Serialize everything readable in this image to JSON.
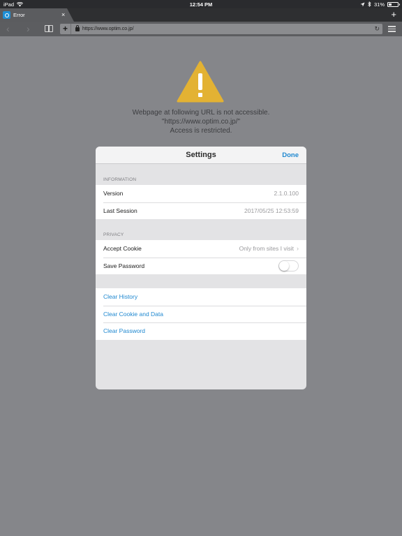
{
  "status_bar": {
    "device": "iPad",
    "time": "12:54 PM",
    "battery": "31%"
  },
  "tab": {
    "title": "Error",
    "close": "×",
    "new_tab": "+"
  },
  "toolbar": {
    "back": "‹",
    "forward": "›",
    "add": "+",
    "url": "https://www.optim.co.jp/",
    "reload": "↻"
  },
  "error": {
    "line1": "Webpage at following URL is not accessible.",
    "line2": "\"https://www.optim.co.jp/\"",
    "line3": "Access is restricted."
  },
  "settings": {
    "title": "Settings",
    "done": "Done",
    "information": {
      "header": "INFORMATION",
      "version_label": "Version",
      "version_value": "2.1.0.100",
      "last_session_label": "Last Session",
      "last_session_value": "2017/05/25 12:53:59"
    },
    "privacy": {
      "header": "PRIVACY",
      "accept_cookie_label": "Accept Cookie",
      "accept_cookie_value": "Only from sites I visit",
      "save_password_label": "Save Password",
      "save_password_on": false
    },
    "actions": {
      "clear_history": "Clear History",
      "clear_cookie": "Clear Cookie and Data",
      "clear_password": "Clear Password"
    }
  },
  "colors": {
    "accent": "#1f88d0",
    "warning": "#e3b233",
    "overlay": "#85868a"
  }
}
